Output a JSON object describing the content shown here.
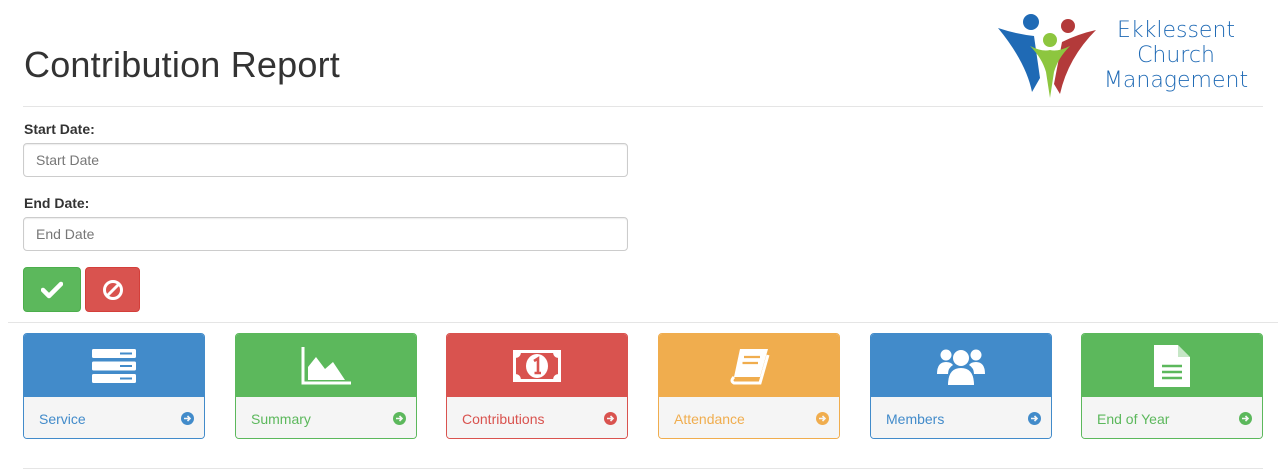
{
  "header": {
    "title": "Contribution Report",
    "logo": {
      "line1": "Ekklessent",
      "line2": "Church",
      "line3": "Management"
    }
  },
  "form": {
    "start_date": {
      "label": "Start Date:",
      "placeholder": "Start Date",
      "value": ""
    },
    "end_date": {
      "label": "End Date:",
      "placeholder": "End Date",
      "value": ""
    },
    "submit_icon": "check-icon",
    "cancel_icon": "ban-icon"
  },
  "tiles": [
    {
      "label": "Service",
      "icon": "server-icon",
      "color": "#428bca"
    },
    {
      "label": "Summary",
      "icon": "area-chart-icon",
      "color": "#5cb85c"
    },
    {
      "label": "Contributions",
      "icon": "money-icon",
      "color": "#d9534f"
    },
    {
      "label": "Attendance",
      "icon": "book-icon",
      "color": "#f0ad4e"
    },
    {
      "label": "Members",
      "icon": "users-icon",
      "color": "#428bca"
    },
    {
      "label": "End of Year",
      "icon": "file-text-icon",
      "color": "#5cb85c"
    }
  ],
  "colors": {
    "primary": "#428bca",
    "success": "#5cb85c",
    "danger": "#d9534f",
    "warning": "#f0ad4e",
    "logo_blue": "#1f6ab5"
  }
}
